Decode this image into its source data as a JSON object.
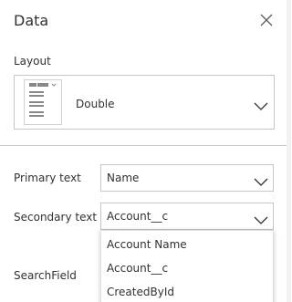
{
  "panel": {
    "title": "Data"
  },
  "layout": {
    "label": "Layout",
    "selected": "Double"
  },
  "fields": {
    "primary": {
      "label": "Primary text",
      "value": "Name"
    },
    "secondary": {
      "label": "Secondary text",
      "value": "Account__c"
    },
    "search": {
      "label": "SearchField"
    }
  },
  "secondary_dropdown": {
    "options": [
      "Account Name",
      "Account__c",
      "CreatedById"
    ]
  },
  "icons": {
    "close": "close-icon",
    "chevron": "chevron-down-icon",
    "layout_thumbnail": "layout-double-thumbnail-icon"
  },
  "colors": {
    "border": "#c8c6c4",
    "text": "#323130",
    "thumb": "#8a8886"
  }
}
